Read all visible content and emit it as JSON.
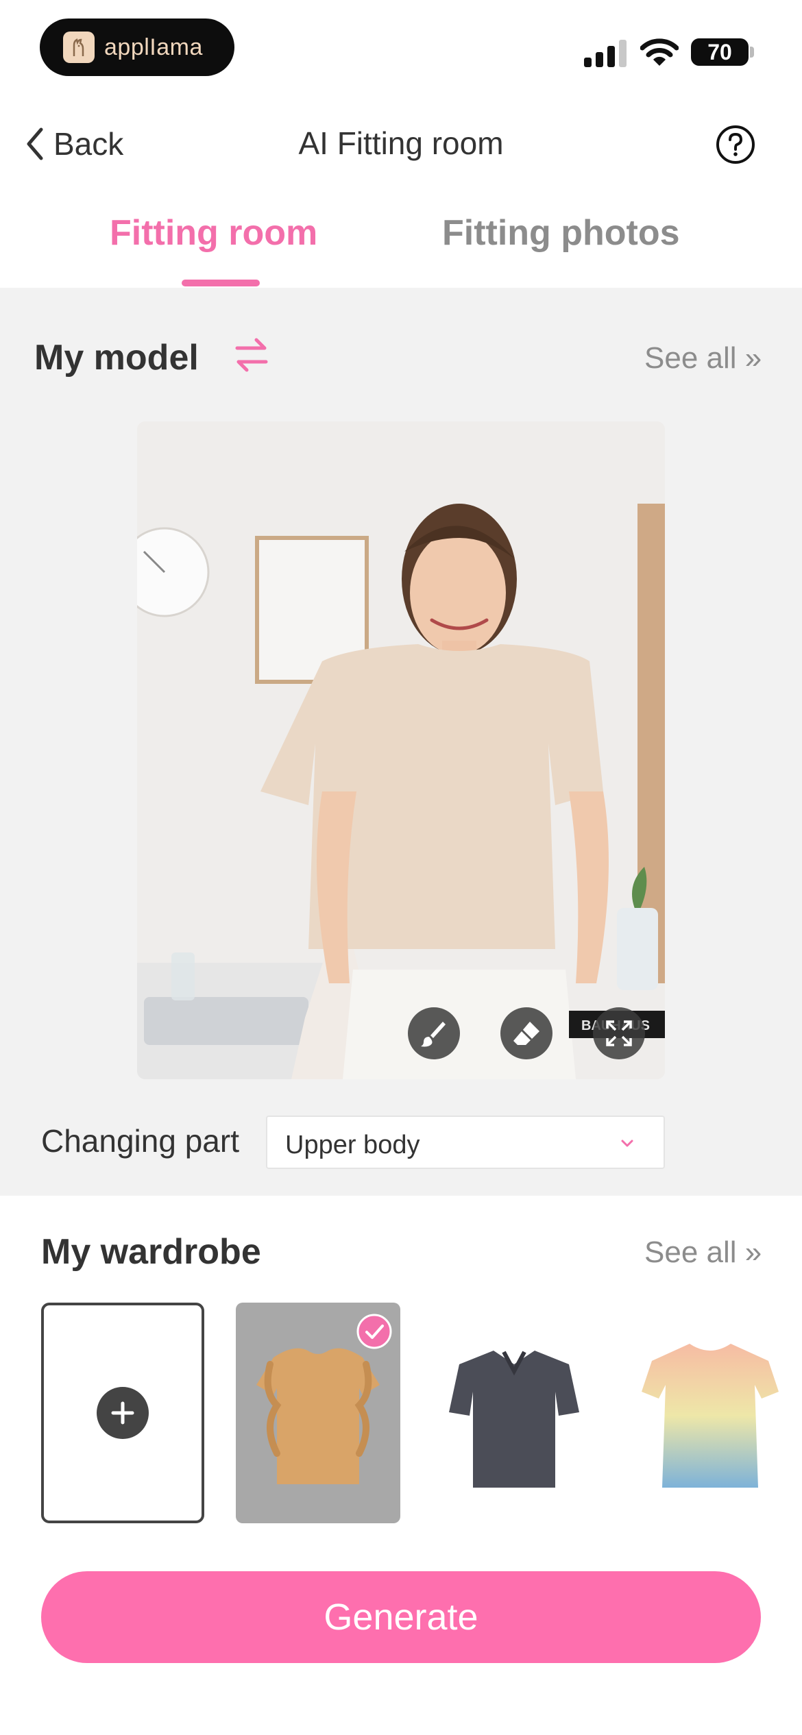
{
  "status_bar": {
    "app_badge": "applIama",
    "battery": "70"
  },
  "nav": {
    "back_label": "Back",
    "title": "AI Fitting room"
  },
  "tabs": [
    {
      "label": "Fitting room",
      "active": true
    },
    {
      "label": "Fitting photos",
      "active": false
    }
  ],
  "model_section": {
    "title": "My model",
    "see_all": "See all »",
    "photo_caption_text": "BAUHAUS"
  },
  "changing_part": {
    "label": "Changing part",
    "selected": "Upper body"
  },
  "wardrobe": {
    "title": "My wardrobe",
    "see_all": "See all »",
    "items": [
      {
        "name": "ruffle-top",
        "color": "#d9a468",
        "selected": true
      },
      {
        "name": "polo-shirt",
        "color": "#4b4d57",
        "selected": false
      },
      {
        "name": "gradient-tshirt",
        "color": "#f4c4a0",
        "selected": false
      }
    ]
  },
  "generate_label": "Generate",
  "colors": {
    "accent": "#f36fab",
    "button": "#fe6fae",
    "section_bg": "#f2f2f2"
  }
}
